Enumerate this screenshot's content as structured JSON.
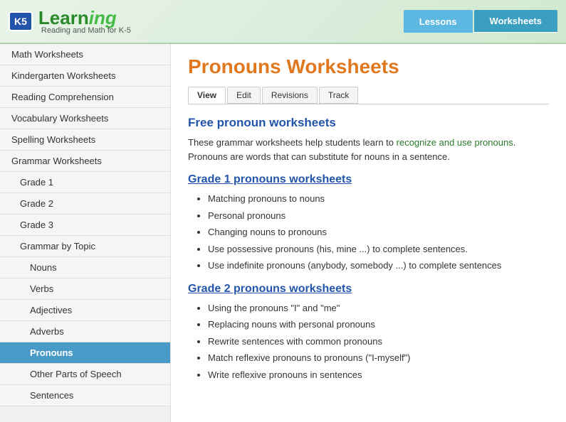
{
  "header": {
    "logo_k5": "K5",
    "logo_learning": "Learn",
    "logo_suffix": "ing",
    "tagline": "Reading and Math for K-5",
    "nav_lessons": "Lessons",
    "nav_worksheets": "Worksheets"
  },
  "sidebar": {
    "items": [
      {
        "label": "Math Worksheets",
        "level": 0,
        "active": false
      },
      {
        "label": "Kindergarten Worksheets",
        "level": 0,
        "active": false
      },
      {
        "label": "Reading Comprehension",
        "level": 0,
        "active": false
      },
      {
        "label": "Vocabulary Worksheets",
        "level": 0,
        "active": false
      },
      {
        "label": "Spelling Worksheets",
        "level": 0,
        "active": false
      },
      {
        "label": "Grammar Worksheets",
        "level": 0,
        "active": false
      },
      {
        "label": "Grade 1",
        "level": 1,
        "active": false
      },
      {
        "label": "Grade 2",
        "level": 1,
        "active": false
      },
      {
        "label": "Grade 3",
        "level": 1,
        "active": false
      },
      {
        "label": "Grammar by Topic",
        "level": 1,
        "active": false
      },
      {
        "label": "Nouns",
        "level": 2,
        "active": false
      },
      {
        "label": "Verbs",
        "level": 2,
        "active": false
      },
      {
        "label": "Adjectives",
        "level": 2,
        "active": false
      },
      {
        "label": "Adverbs",
        "level": 2,
        "active": false
      },
      {
        "label": "Pronouns",
        "level": 2,
        "active": true
      },
      {
        "label": "Other Parts of Speech",
        "level": 2,
        "active": false
      },
      {
        "label": "Sentences",
        "level": 2,
        "active": false
      }
    ]
  },
  "main": {
    "page_title": "Pronouns Worksheets",
    "tabs": [
      "View",
      "Edit",
      "Revisions",
      "Track"
    ],
    "active_tab": "View",
    "section_title": "Free pronoun worksheets",
    "intro": "These grammar worksheets help students learn to ",
    "intro_highlight": "recognize and use pronouns",
    "intro_rest": ". Pronouns are words that can substitute for nouns in a sentence.",
    "grade1": {
      "heading": "Grade 1 pronouns worksheets",
      "items": [
        "Matching pronouns to nouns",
        "Personal pronouns",
        "Changing nouns to pronouns",
        "Use possessive pronouns (his, mine ...) to complete sentences.",
        "Use indefinite pronouns (anybody, somebody ...) to complete sentences"
      ]
    },
    "grade2": {
      "heading": "Grade 2 pronouns worksheets",
      "items": [
        "Using the pronouns \"I\" and \"me\"",
        "Replacing nouns with personal pronouns",
        "Rewrite sentences with common pronouns",
        "Match reflexive pronouns to pronouns (\"I-myself\")",
        "Write reflexive pronouns in sentences"
      ]
    }
  }
}
